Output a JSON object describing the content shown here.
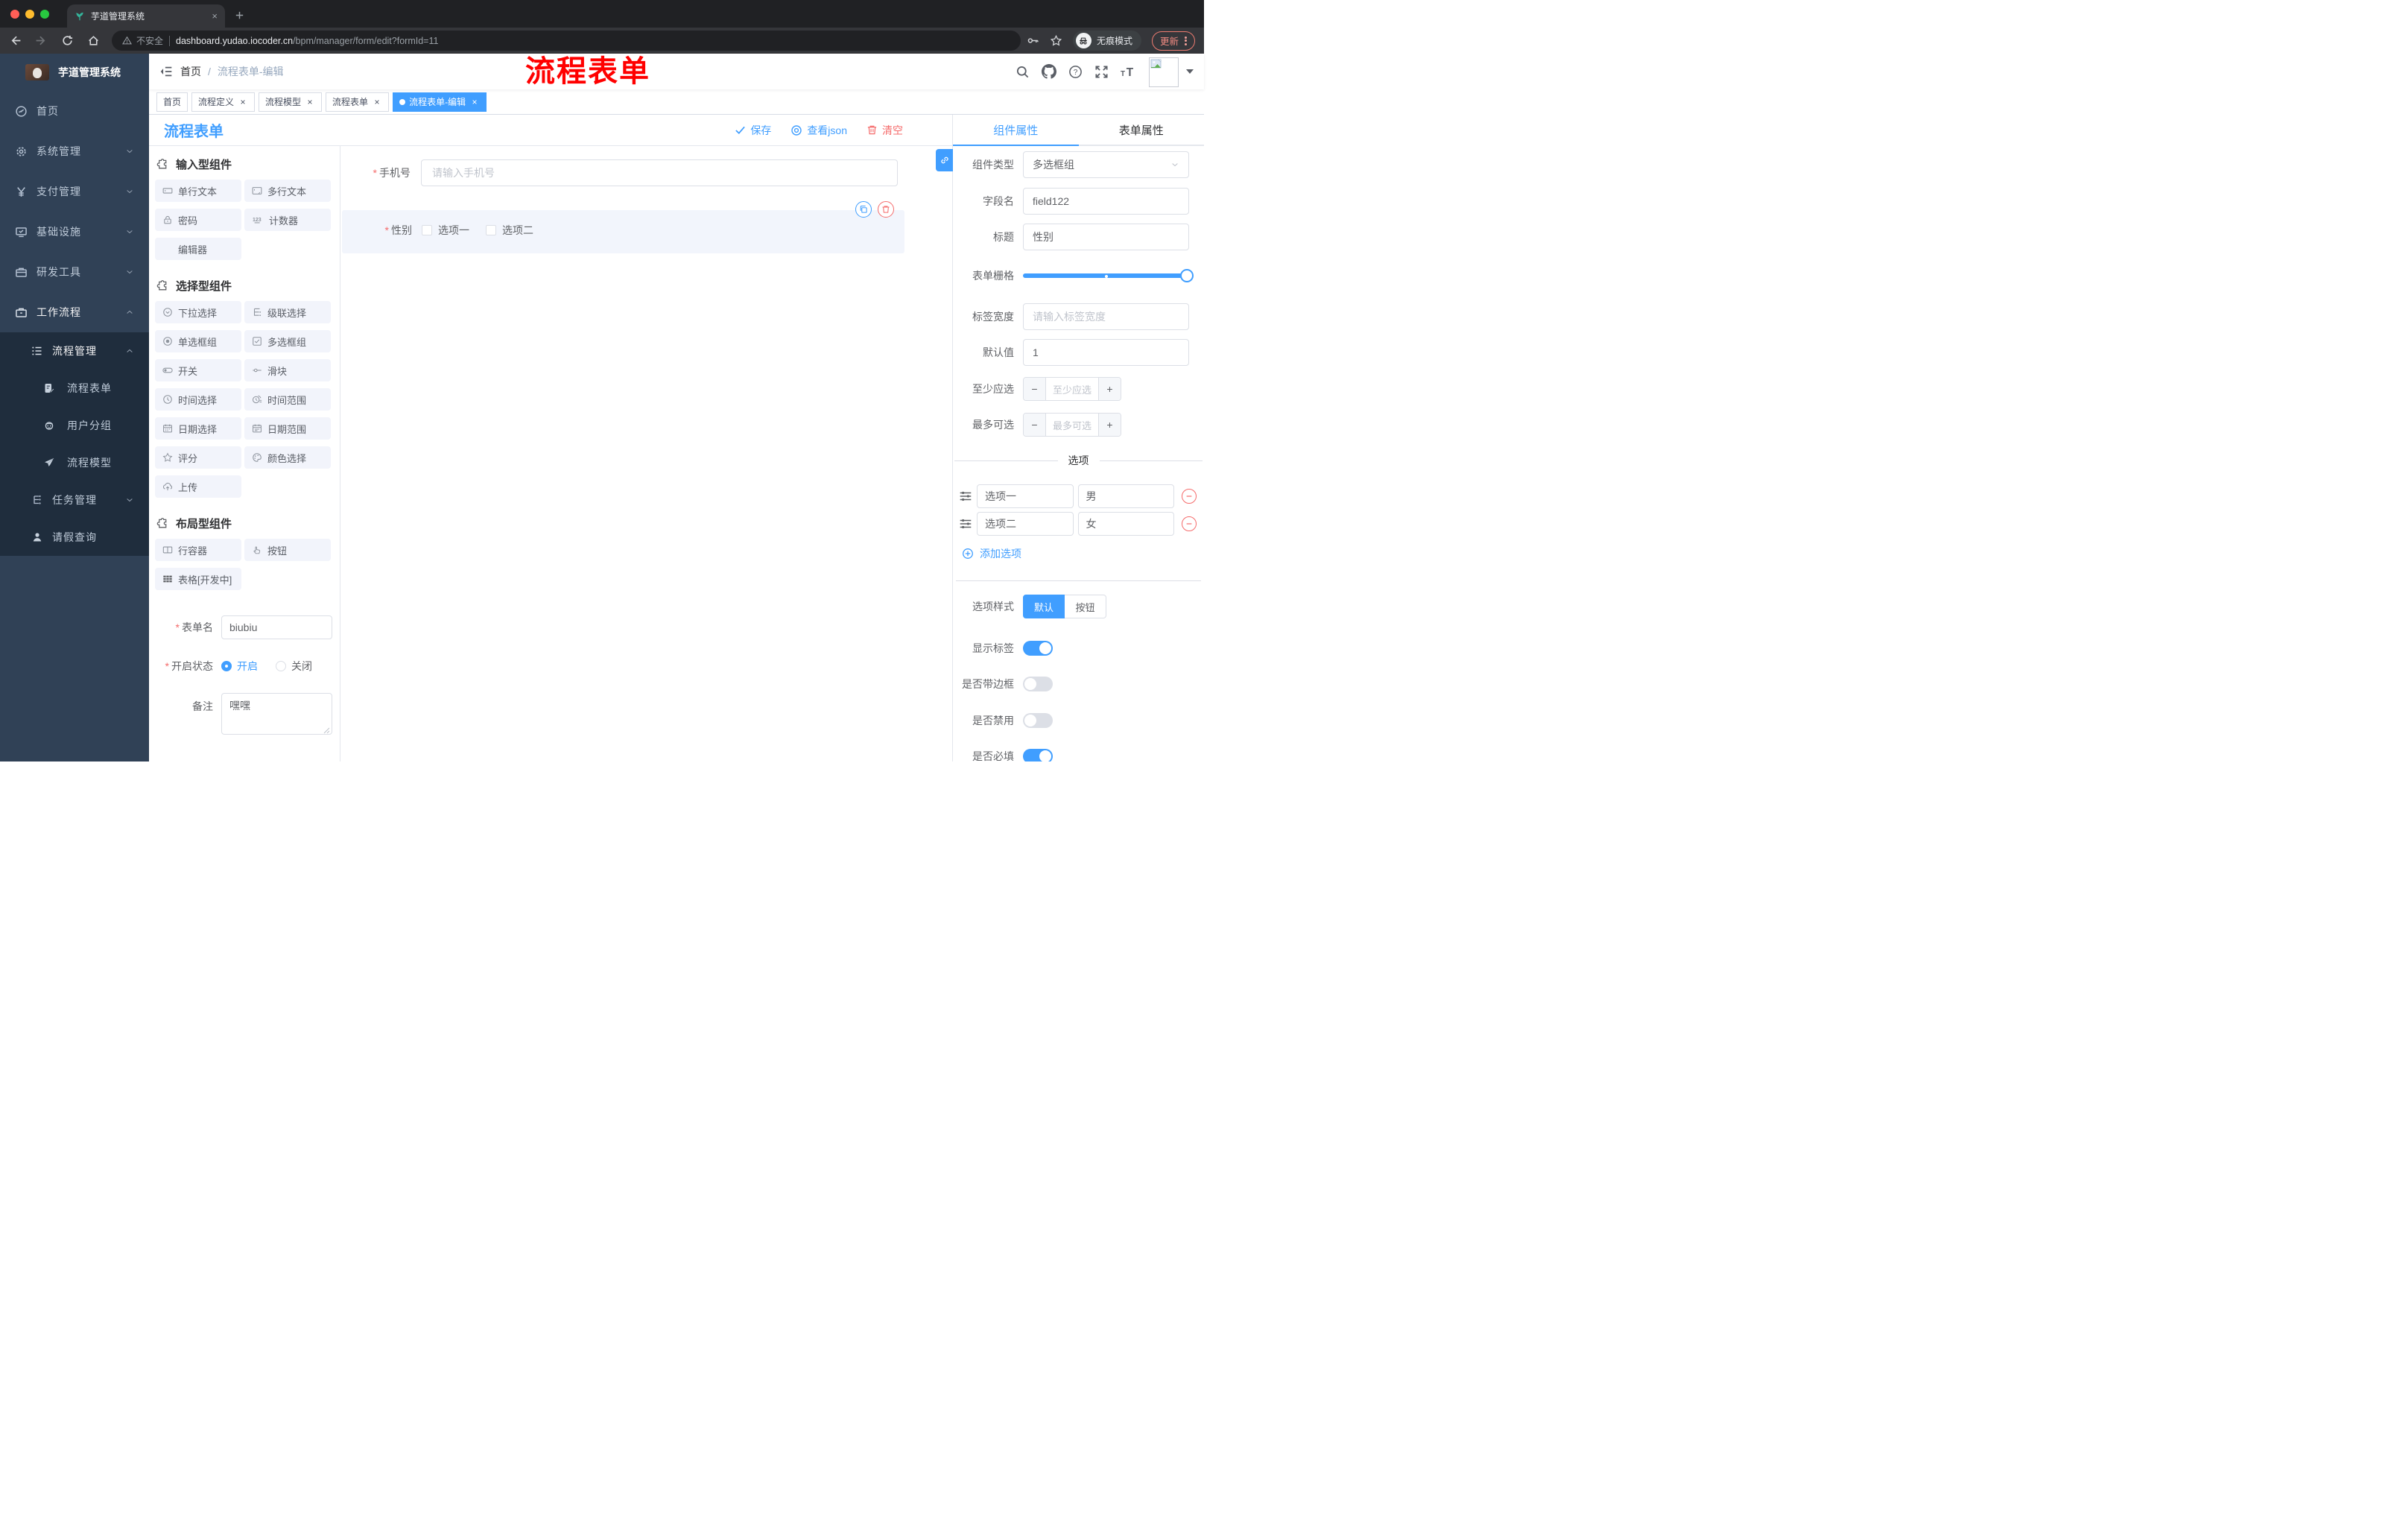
{
  "colors": {
    "primary": "#409EFF",
    "danger": "#F56C6C",
    "annotation": "#FF0000"
  },
  "misc": {
    "req": "*",
    "close": "×"
  },
  "browser": {
    "tab_title": "芋道管理系统",
    "security": "不安全",
    "url_domain": "dashboard.yudao.iocoder.cn",
    "url_path": "/bpm/manager/form/edit?formId=11",
    "incognito": "无痕模式",
    "update": "更新"
  },
  "annotation": "流程表单",
  "header": {
    "breadcrumb_home": "首页",
    "breadcrumb_sep": "/",
    "breadcrumb_current": "流程表单-编辑"
  },
  "tags": [
    {
      "label": "首页"
    },
    {
      "label": "流程定义"
    },
    {
      "label": "流程模型"
    },
    {
      "label": "流程表单"
    },
    {
      "label": "流程表单-编辑"
    }
  ],
  "sidebar": {
    "logo_title": "芋道管理系统",
    "items": [
      {
        "label": "首页"
      },
      {
        "label": "系统管理"
      },
      {
        "label": "支付管理"
      },
      {
        "label": "基础设施"
      },
      {
        "label": "研发工具"
      },
      {
        "label": "工作流程"
      },
      {
        "label": "流程管理"
      },
      {
        "label": "流程表单"
      },
      {
        "label": "用户分组"
      },
      {
        "label": "流程模型"
      },
      {
        "label": "任务管理"
      },
      {
        "label": "请假查询"
      }
    ]
  },
  "workspace": {
    "title": "流程表单",
    "save": "保存",
    "view_json": "查看json",
    "clear": "清空"
  },
  "palette": {
    "sections": [
      {
        "title": "输入型组件",
        "items": [
          {
            "label": "单行文本"
          },
          {
            "label": "多行文本"
          },
          {
            "label": "密码"
          },
          {
            "label": "计数器"
          },
          {
            "label": "编辑器"
          }
        ]
      },
      {
        "title": "选择型组件",
        "items": [
          {
            "label": "下拉选择"
          },
          {
            "label": "级联选择"
          },
          {
            "label": "单选框组"
          },
          {
            "label": "多选框组"
          },
          {
            "label": "开关"
          },
          {
            "label": "滑块"
          },
          {
            "label": "时间选择"
          },
          {
            "label": "时间范围"
          },
          {
            "label": "日期选择"
          },
          {
            "label": "日期范围"
          },
          {
            "label": "评分"
          },
          {
            "label": "颜色选择"
          },
          {
            "label": "上传"
          }
        ]
      },
      {
        "title": "布局型组件",
        "items": [
          {
            "label": "行容器"
          },
          {
            "label": "按钮"
          },
          {
            "label": "表格[开发中]"
          }
        ]
      }
    ],
    "form": {
      "name_label": "表单名",
      "name_value": "biubiu",
      "status_label": "开启状态",
      "status_on": "开启",
      "status_off": "关闭",
      "remark_label": "备注",
      "remark_value": "嘿嘿"
    }
  },
  "canvas": {
    "phone_label": "手机号",
    "phone_placeholder": "请输入手机号",
    "gender_label": "性别",
    "gender_option1": "选项一",
    "gender_option2": "选项二"
  },
  "inspector": {
    "tab_component": "组件属性",
    "tab_form": "表单属性",
    "type_label": "组件类型",
    "type_value": "多选框组",
    "field_label": "字段名",
    "field_value": "field122",
    "title_label": "标题",
    "title_value": "性别",
    "grid_label": "表单栅格",
    "label_width_label": "标签宽度",
    "label_width_placeholder": "请输入标签宽度",
    "default_label": "默认值",
    "default_value": "1",
    "min_label": "至少应选",
    "min_placeholder": "至少应选",
    "max_label": "最多可选",
    "max_placeholder": "最多可选",
    "options_title": "选项",
    "options": [
      {
        "name": "选项一",
        "value": "男"
      },
      {
        "name": "选项二",
        "value": "女"
      }
    ],
    "add_option": "添加选项",
    "style_label": "选项样式",
    "style_default": "默认",
    "style_button": "按钮",
    "show_label_label": "显示标签",
    "border_label": "是否带边框",
    "disabled_label": "是否禁用",
    "required_label": "是否必填"
  }
}
